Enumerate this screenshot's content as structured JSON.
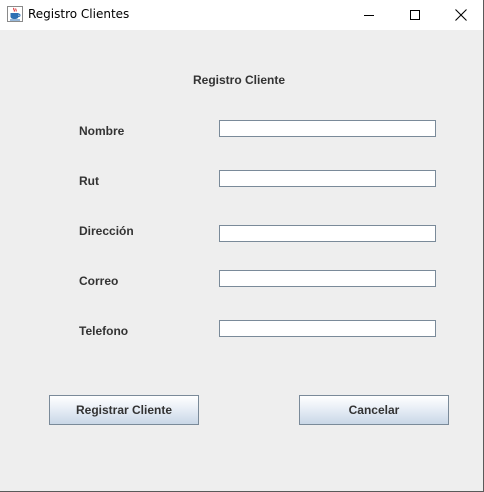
{
  "window": {
    "title": "Registro Clientes"
  },
  "icons": {
    "app": "java-cup-icon",
    "minimize": "minimize-icon",
    "maximize": "maximize-icon",
    "close": "close-icon"
  },
  "form": {
    "heading": "Registro Cliente",
    "fields": [
      {
        "label": "Nombre",
        "value": ""
      },
      {
        "label": "Rut",
        "value": ""
      },
      {
        "label": "Dirección",
        "value": ""
      },
      {
        "label": "Correo",
        "value": ""
      },
      {
        "label": "Telefono",
        "value": ""
      }
    ]
  },
  "buttons": {
    "register_label": "Registrar Cliente",
    "cancel_label": "Cancelar"
  },
  "colors": {
    "panel_background": "#eeeeee",
    "field_border": "#7a8a99",
    "label_text": "#333333"
  }
}
